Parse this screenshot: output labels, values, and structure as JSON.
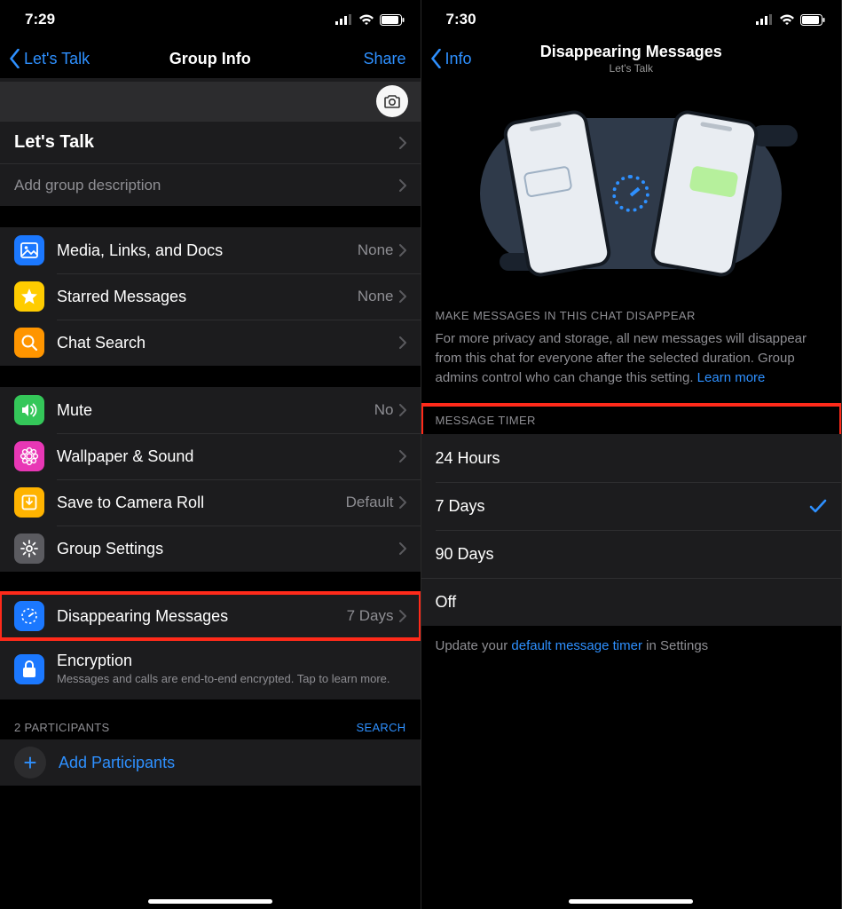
{
  "left": {
    "status_time": "7:29",
    "back_label": "Let's Talk",
    "title": "Group Info",
    "share_label": "Share",
    "group_name": "Let's Talk",
    "group_desc_placeholder": "Add group description",
    "rows": {
      "media": {
        "label": "Media, Links, and Docs",
        "value": "None"
      },
      "starred": {
        "label": "Starred Messages",
        "value": "None"
      },
      "search": {
        "label": "Chat Search"
      },
      "mute": {
        "label": "Mute",
        "value": "No"
      },
      "wallpaper": {
        "label": "Wallpaper & Sound"
      },
      "camera_roll": {
        "label": "Save to Camera Roll",
        "value": "Default"
      },
      "group_settings": {
        "label": "Group Settings"
      },
      "disappearing": {
        "label": "Disappearing Messages",
        "value": "7 Days"
      },
      "encryption": {
        "label": "Encryption",
        "sub": "Messages and calls are end-to-end encrypted. Tap to learn more."
      }
    },
    "participants_label": "2 PARTICIPANTS",
    "participants_search": "SEARCH",
    "add_participants": "Add Participants"
  },
  "right": {
    "status_time": "7:30",
    "back_label": "Info",
    "title": "Disappearing Messages",
    "subtitle": "Let's Talk",
    "section1_header": "MAKE MESSAGES IN THIS CHAT DISAPPEAR",
    "description": "For more privacy and storage, all new messages will disappear from this chat for everyone after the selected duration. Group admins control who can change this setting. ",
    "learn_more": "Learn more",
    "timer_header": "MESSAGE TIMER",
    "options": {
      "h24": "24 Hours",
      "d7": "7 Days",
      "d90": "90 Days",
      "off": "Off"
    },
    "selected": "d7",
    "footer_pre": "Update your ",
    "footer_link": "default message timer",
    "footer_post": " in Settings"
  }
}
